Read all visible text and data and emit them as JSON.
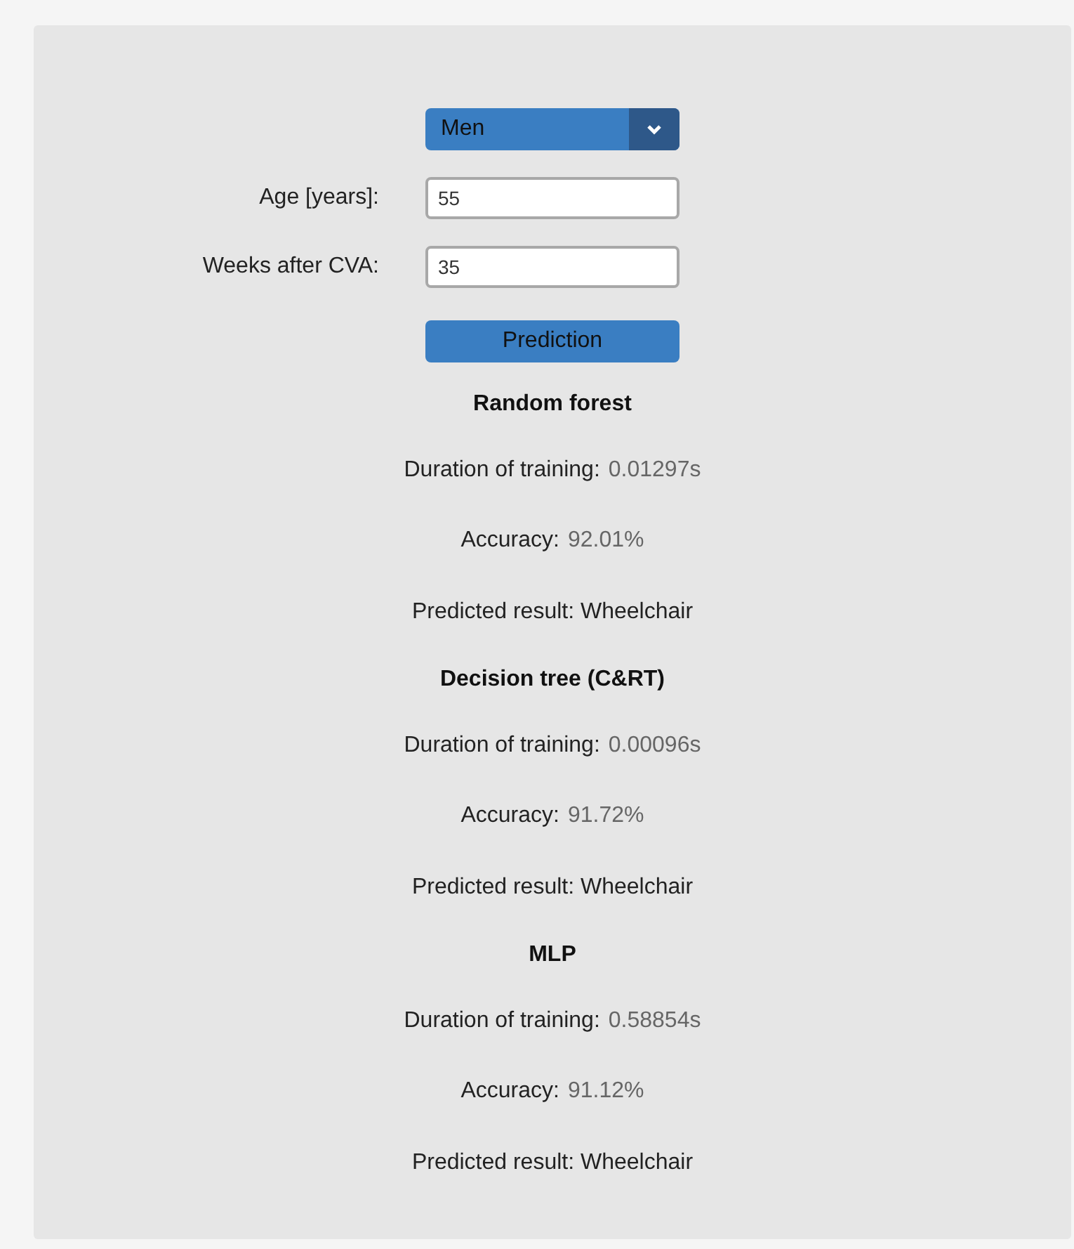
{
  "form": {
    "gender_select": {
      "value": "Men"
    },
    "fields": [
      {
        "label": "Age [years]:",
        "value": "55"
      },
      {
        "label": "Weeks after CVA:",
        "value": "35"
      }
    ],
    "submit_button": "Prediction"
  },
  "results": [
    {
      "title": "Random forest",
      "duration_label": "Duration of training:",
      "duration_value": "0.01297s",
      "accuracy_label": "Accuracy:",
      "accuracy_value": "92.01%",
      "prediction": "Predicted result: Wheelchair"
    },
    {
      "title": "Decision tree (C&RT)",
      "duration_label": "Duration of training:",
      "duration_value": "0.00096s",
      "accuracy_label": "Accuracy:",
      "accuracy_value": "91.72%",
      "prediction": "Predicted result: Wheelchair"
    },
    {
      "title": "MLP",
      "duration_label": "Duration of training:",
      "duration_value": "0.58854s",
      "accuracy_label": "Accuracy:",
      "accuracy_value": "91.12%",
      "prediction": "Predicted result: Wheelchair"
    }
  ]
}
